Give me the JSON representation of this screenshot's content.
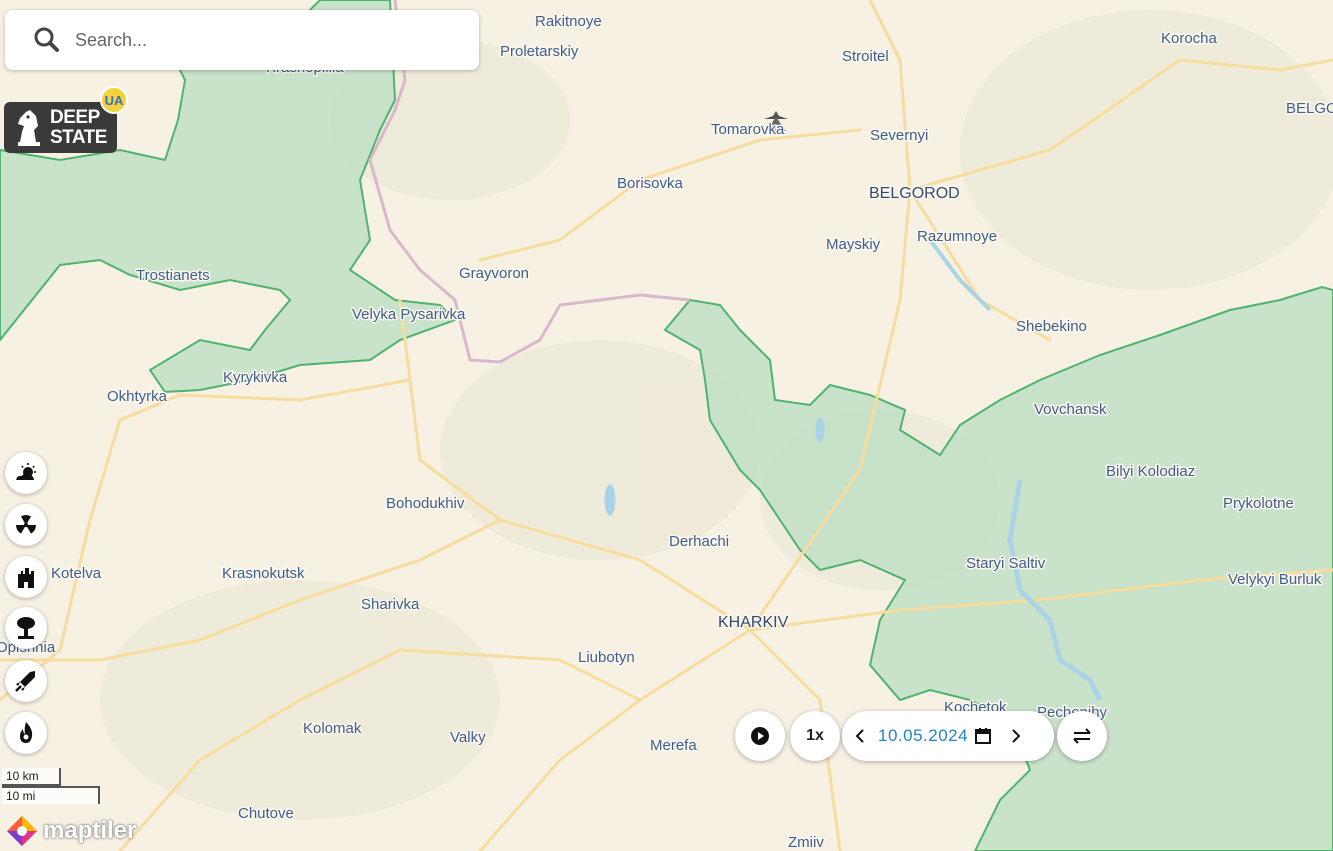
{
  "search": {
    "placeholder": "Search..."
  },
  "logo": {
    "line1": "DEEP",
    "line2": "STATE",
    "badge": "UA"
  },
  "tools": [
    {
      "name": "weather-icon"
    },
    {
      "name": "radiation-icon"
    },
    {
      "name": "fortification-icon"
    },
    {
      "name": "explosion-icon"
    },
    {
      "name": "missile-icon"
    },
    {
      "name": "fire-icon"
    }
  ],
  "scale": {
    "km": "10 km",
    "mi": "10 mi"
  },
  "attribution": {
    "text": "maptiler"
  },
  "timeline": {
    "speed": "1x",
    "date": "10.05.2024"
  },
  "colors": {
    "occupied_fill": "#bfe0c6",
    "occupied_border": "#4fb36d",
    "border_line": "#d9b8cc",
    "water": "#a8d4e6",
    "road": "#f6dd9e",
    "label": "#3f5f8a",
    "date_text": "#1f86c8"
  },
  "places": [
    {
      "id": "rakitnoye",
      "name": "Rakitnoye"
    },
    {
      "id": "proletarskiy",
      "name": "Proletarskiy"
    },
    {
      "id": "stroitel",
      "name": "Stroitel"
    },
    {
      "id": "korocha",
      "name": "Korocha"
    },
    {
      "id": "krasnopillia",
      "name": "Krasnopillia"
    },
    {
      "id": "tomarovka",
      "name": "Tomarovka"
    },
    {
      "id": "severnyi",
      "name": "Severnyi"
    },
    {
      "id": "belgo",
      "name": "BELGO"
    },
    {
      "id": "borisovka",
      "name": "Borisovka"
    },
    {
      "id": "belgorod",
      "name": "BELGOROD"
    },
    {
      "id": "mayskiy",
      "name": "Mayskiy"
    },
    {
      "id": "razumnoye",
      "name": "Razumnoye"
    },
    {
      "id": "trostianets",
      "name": "Trostianets"
    },
    {
      "id": "grayvoron",
      "name": "Grayvoron"
    },
    {
      "id": "velyka_pysarivka",
      "name": "Velyka Pysarivka"
    },
    {
      "id": "shebekino",
      "name": "Shebekino"
    },
    {
      "id": "kyrykivka",
      "name": "Kyrykivka"
    },
    {
      "id": "okhtyrka",
      "name": "Okhtyrka"
    },
    {
      "id": "vovchansk",
      "name": "Vovchansk"
    },
    {
      "id": "bilyi_kolodiaz",
      "name": "Bilyi Kolodiaz"
    },
    {
      "id": "bohodukhiv",
      "name": "Bohodukhiv"
    },
    {
      "id": "prykolotne",
      "name": "Prykolotne"
    },
    {
      "id": "derhachi",
      "name": "Derhachi"
    },
    {
      "id": "staryi_saltiv",
      "name": "Staryi Saltiv"
    },
    {
      "id": "kotelva",
      "name": "Kotelva"
    },
    {
      "id": "krasnokutsk",
      "name": "Krasnokutsk"
    },
    {
      "id": "velykyi_burluk",
      "name": "Velykyi Burluk"
    },
    {
      "id": "sharivka",
      "name": "Sharivka"
    },
    {
      "id": "kharkiv",
      "name": "KHARKIV"
    },
    {
      "id": "opishnia",
      "name": "Opishnia"
    },
    {
      "id": "liubotyn",
      "name": "Liubotyn"
    },
    {
      "id": "kochetok",
      "name": "Kochetok"
    },
    {
      "id": "pechenihy",
      "name": "Pechenihy"
    },
    {
      "id": "kolomak",
      "name": "Kolomak"
    },
    {
      "id": "valky",
      "name": "Valky"
    },
    {
      "id": "merefa",
      "name": "Merefa"
    },
    {
      "id": "chutove",
      "name": "Chutove"
    },
    {
      "id": "zmiiv",
      "name": "Zmiiv"
    }
  ]
}
